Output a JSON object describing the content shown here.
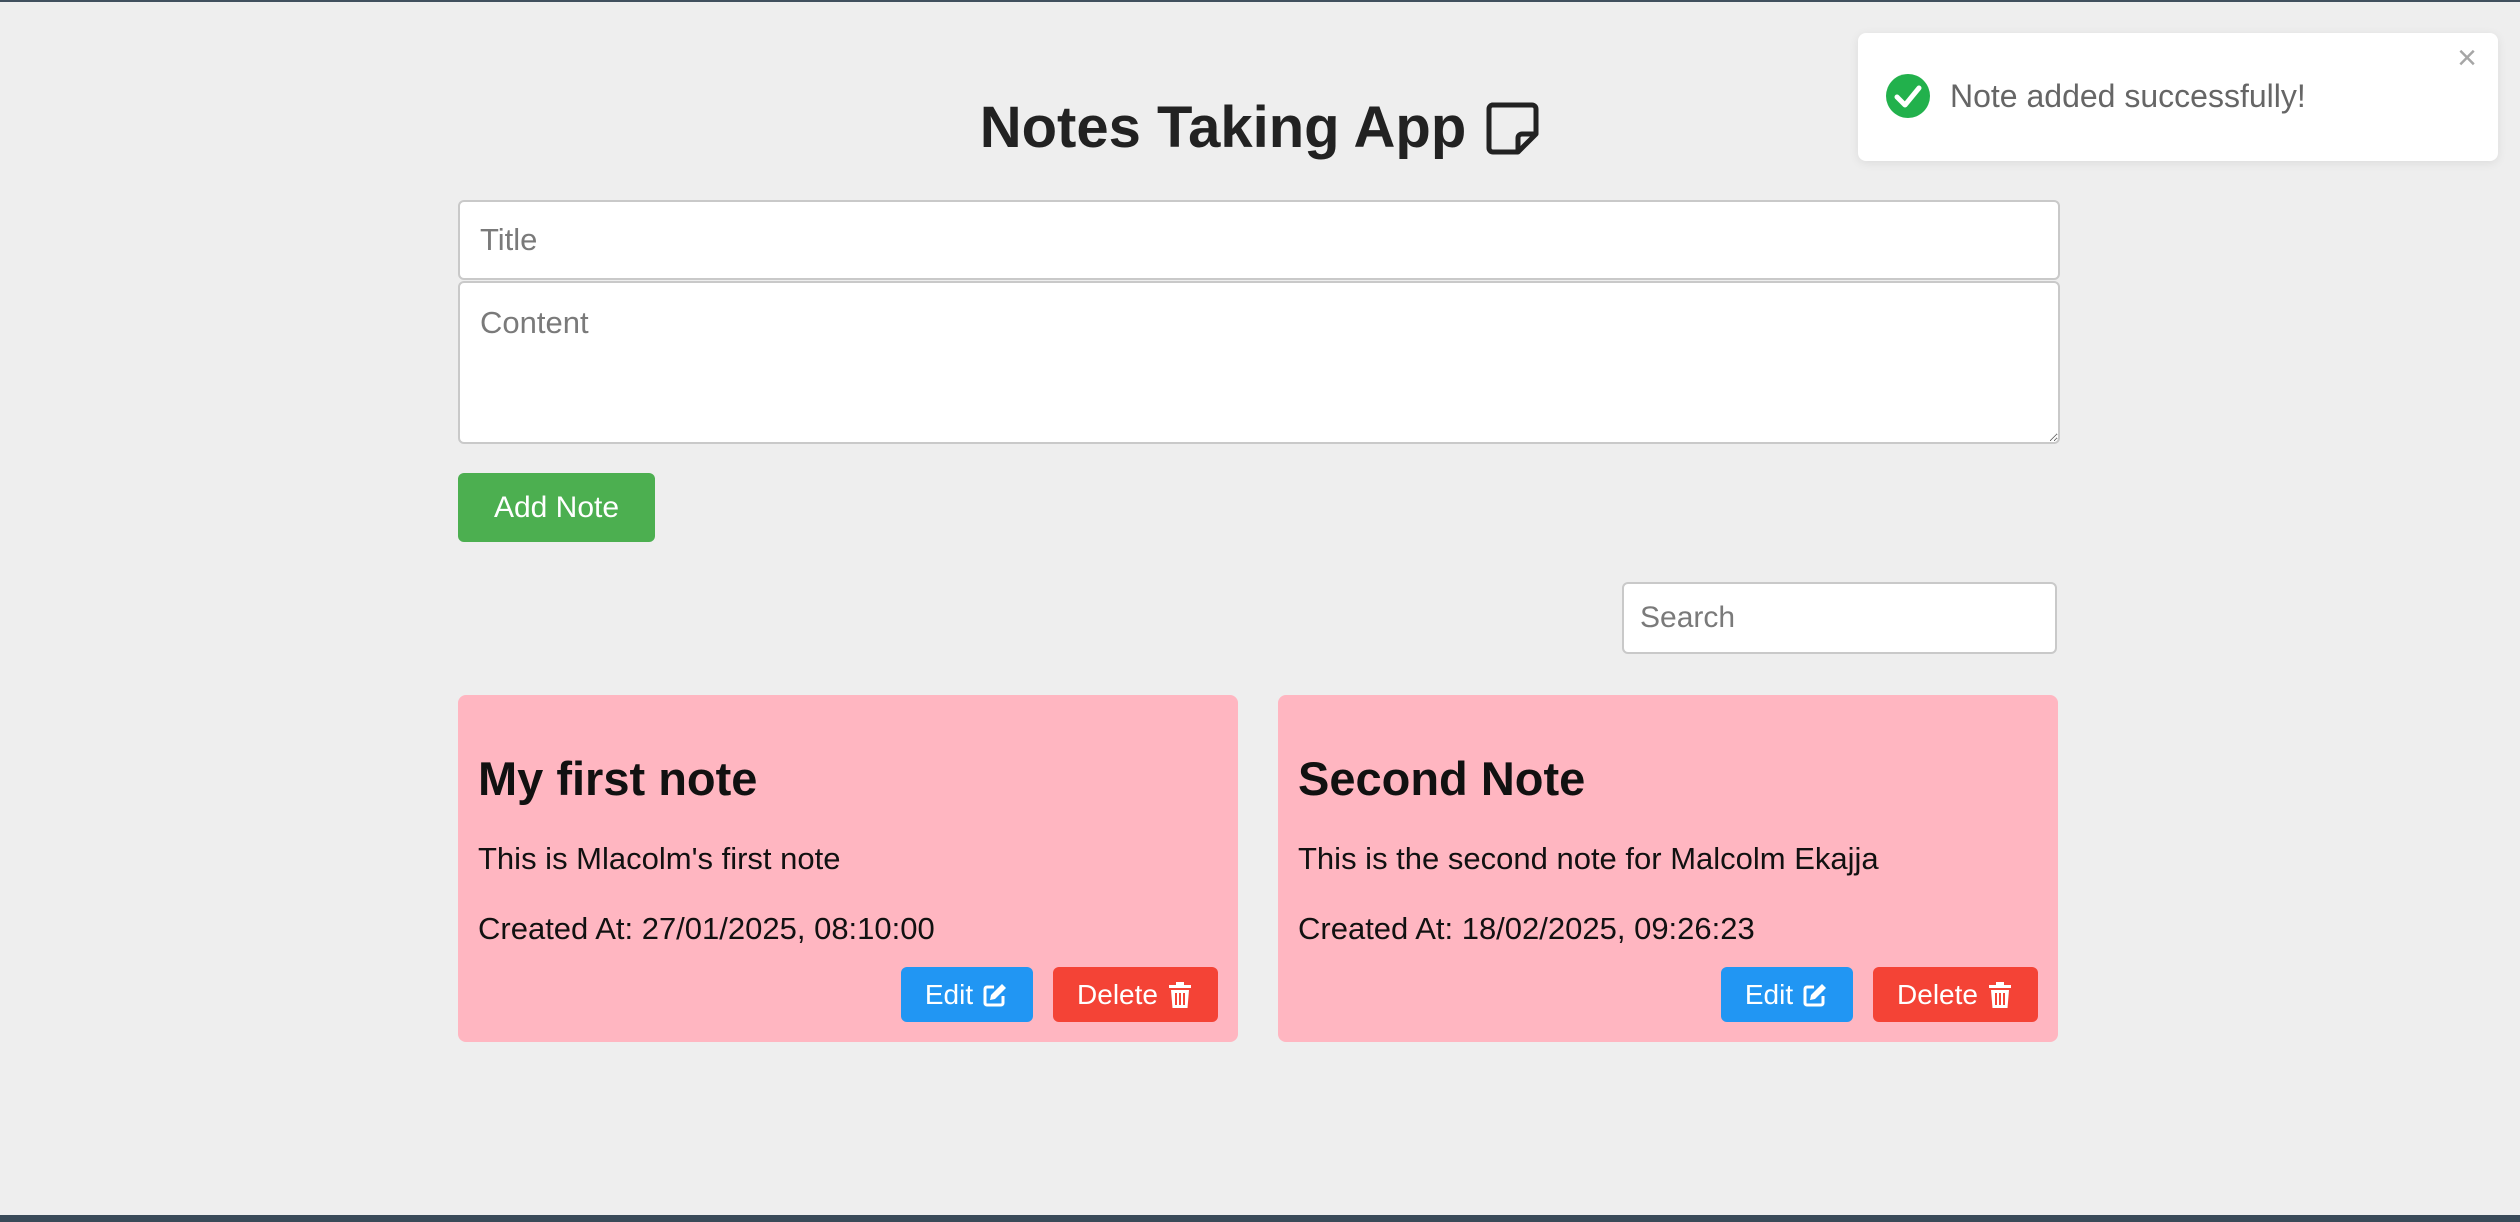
{
  "header": {
    "title": "Notes Taking App",
    "title_icon": "sticky-note-icon"
  },
  "form": {
    "title_placeholder": "Title",
    "title_value": "",
    "content_placeholder": "Content",
    "content_value": "",
    "add_label": "Add Note"
  },
  "search": {
    "placeholder": "Search",
    "value": ""
  },
  "notes": [
    {
      "title": "My first note",
      "content": "This is Mlacolm's first note",
      "created": "Created At: 27/01/2025, 08:10:00",
      "edit_label": "Edit",
      "delete_label": "Delete"
    },
    {
      "title": "Second Note",
      "content": "This is the second note for Malcolm Ekajja",
      "created": "Created At: 18/02/2025, 09:26:23",
      "edit_label": "Edit",
      "delete_label": "Delete"
    }
  ],
  "toast": {
    "message": "Note added successfully!",
    "icon": "check-circle-icon",
    "close_icon": "close-icon"
  },
  "colors": {
    "background": "#eeeeee",
    "add_button": "#4caf50",
    "edit_button": "#2196f3",
    "delete_button": "#f44336",
    "card": "#ffb6c1",
    "success": "#22b14c"
  }
}
